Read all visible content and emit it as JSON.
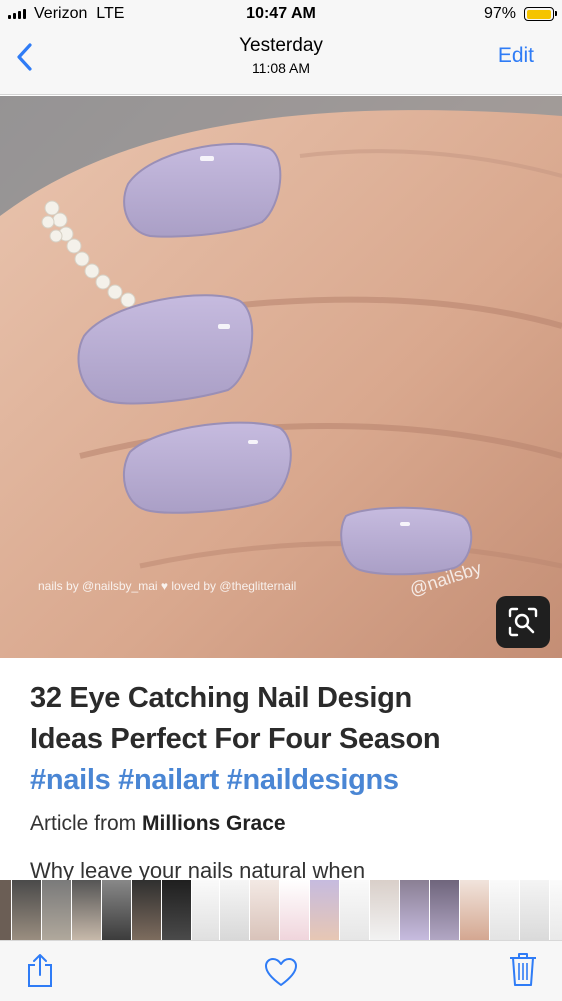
{
  "status_bar": {
    "carrier": "Verizon",
    "network": "LTE",
    "time": "10:47 AM",
    "battery_percent": "97%",
    "battery_level": 0.97
  },
  "navbar": {
    "title": "Yesterday",
    "subtitle": "11:08 AM",
    "edit_label": "Edit",
    "back_icon": "chevron-left-icon"
  },
  "photo": {
    "watermark_left": "nails by @nailsby_mai ♥ loved by @theglitternail",
    "watermark_right": "@nailsby"
  },
  "pin": {
    "title_line_1": "32 Eye Catching Nail Design",
    "title_line_2": "Ideas Perfect For Four Season",
    "hashtags": "#nails #nailart #naildesigns",
    "source_prefix": "Article from",
    "source_name": "Millions Grace",
    "description": "Why leave your nails natural when"
  },
  "toolbar": {
    "share_icon": "share-icon",
    "like_icon": "heart-icon",
    "delete_icon": "trash-icon"
  },
  "colors": {
    "accent": "#2f7cf6",
    "hashtag": "#4a86d4",
    "battery": "#f5c400",
    "nail_polish": "#b9add3"
  }
}
